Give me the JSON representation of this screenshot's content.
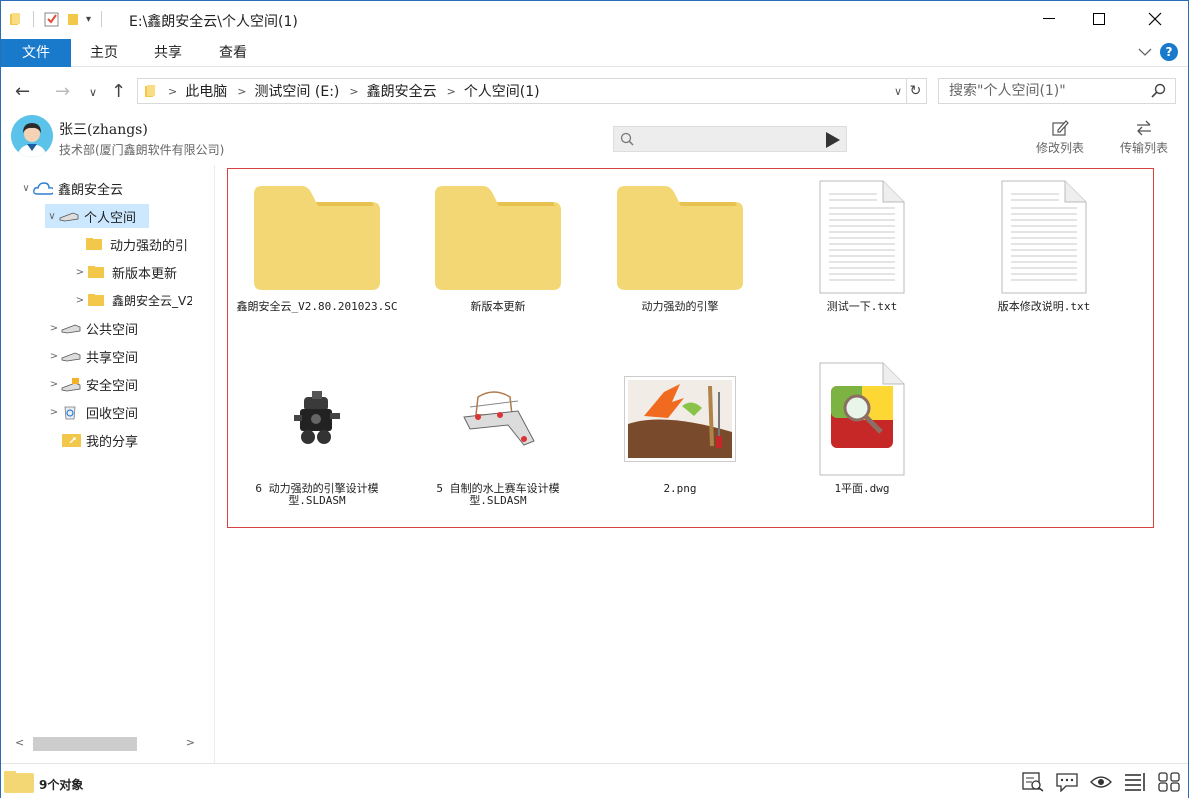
{
  "window": {
    "title": "E:\\鑫朗安全云\\个人空间(1)"
  },
  "ribbon": {
    "tabs": [
      "文件",
      "主页",
      "共享",
      "查看"
    ]
  },
  "address": {
    "crumbs": [
      "此电脑",
      "测试空间 (E:)",
      "鑫朗安全云",
      "个人空间(1)"
    ],
    "search_placeholder": "搜索\"个人空间(1)\""
  },
  "user": {
    "name": "张三(zhangs)",
    "dept": "技术部(厦门鑫朗软件有限公司)",
    "tools": [
      "修改列表",
      "传输列表"
    ]
  },
  "sidebar": {
    "items": [
      {
        "label": "鑫朗安全云",
        "icon": "cloud-icon"
      },
      {
        "label": "个人空间",
        "icon": "drive-icon"
      },
      {
        "label": "动力强劲的引擎",
        "icon": "folder-icon"
      },
      {
        "label": "新版本更新",
        "icon": "folder-icon"
      },
      {
        "label": "鑫朗安全云_V2",
        "icon": "folder-icon"
      },
      {
        "label": "公共空间",
        "icon": "drive-icon"
      },
      {
        "label": "共享空间",
        "icon": "drive-icon"
      },
      {
        "label": "安全空间",
        "icon": "secure-drive-icon"
      },
      {
        "label": "回收空间",
        "icon": "recycle-icon"
      },
      {
        "label": "我的分享",
        "icon": "share-folder-icon"
      }
    ]
  },
  "files": [
    {
      "name": "鑫朗安全云_V2.80.201023.SC",
      "icon": "folder-icon"
    },
    {
      "name": "新版本更新",
      "icon": "folder-icon"
    },
    {
      "name": "动力强劲的引擎",
      "icon": "folder-icon"
    },
    {
      "name": "测试一下.txt",
      "icon": "text-file-icon"
    },
    {
      "name": "版本修改说明.txt",
      "icon": "text-file-icon"
    },
    {
      "name": "6 动力强劲的引擎设计模型.SLDASM",
      "icon": "cad-engine-icon"
    },
    {
      "name": "5 自制的水上赛车设计模型.SLDASM",
      "icon": "cad-boat-icon"
    },
    {
      "name": "2.png",
      "icon": "image-file-icon"
    },
    {
      "name": "1平面.dwg",
      "icon": "dwg-file-icon"
    }
  ],
  "status": {
    "count": "9个对象"
  },
  "colors": {
    "accent": "#1979ca",
    "folder": "#f3d775",
    "selection": "#cce8ff",
    "content_border": "#d94141"
  }
}
